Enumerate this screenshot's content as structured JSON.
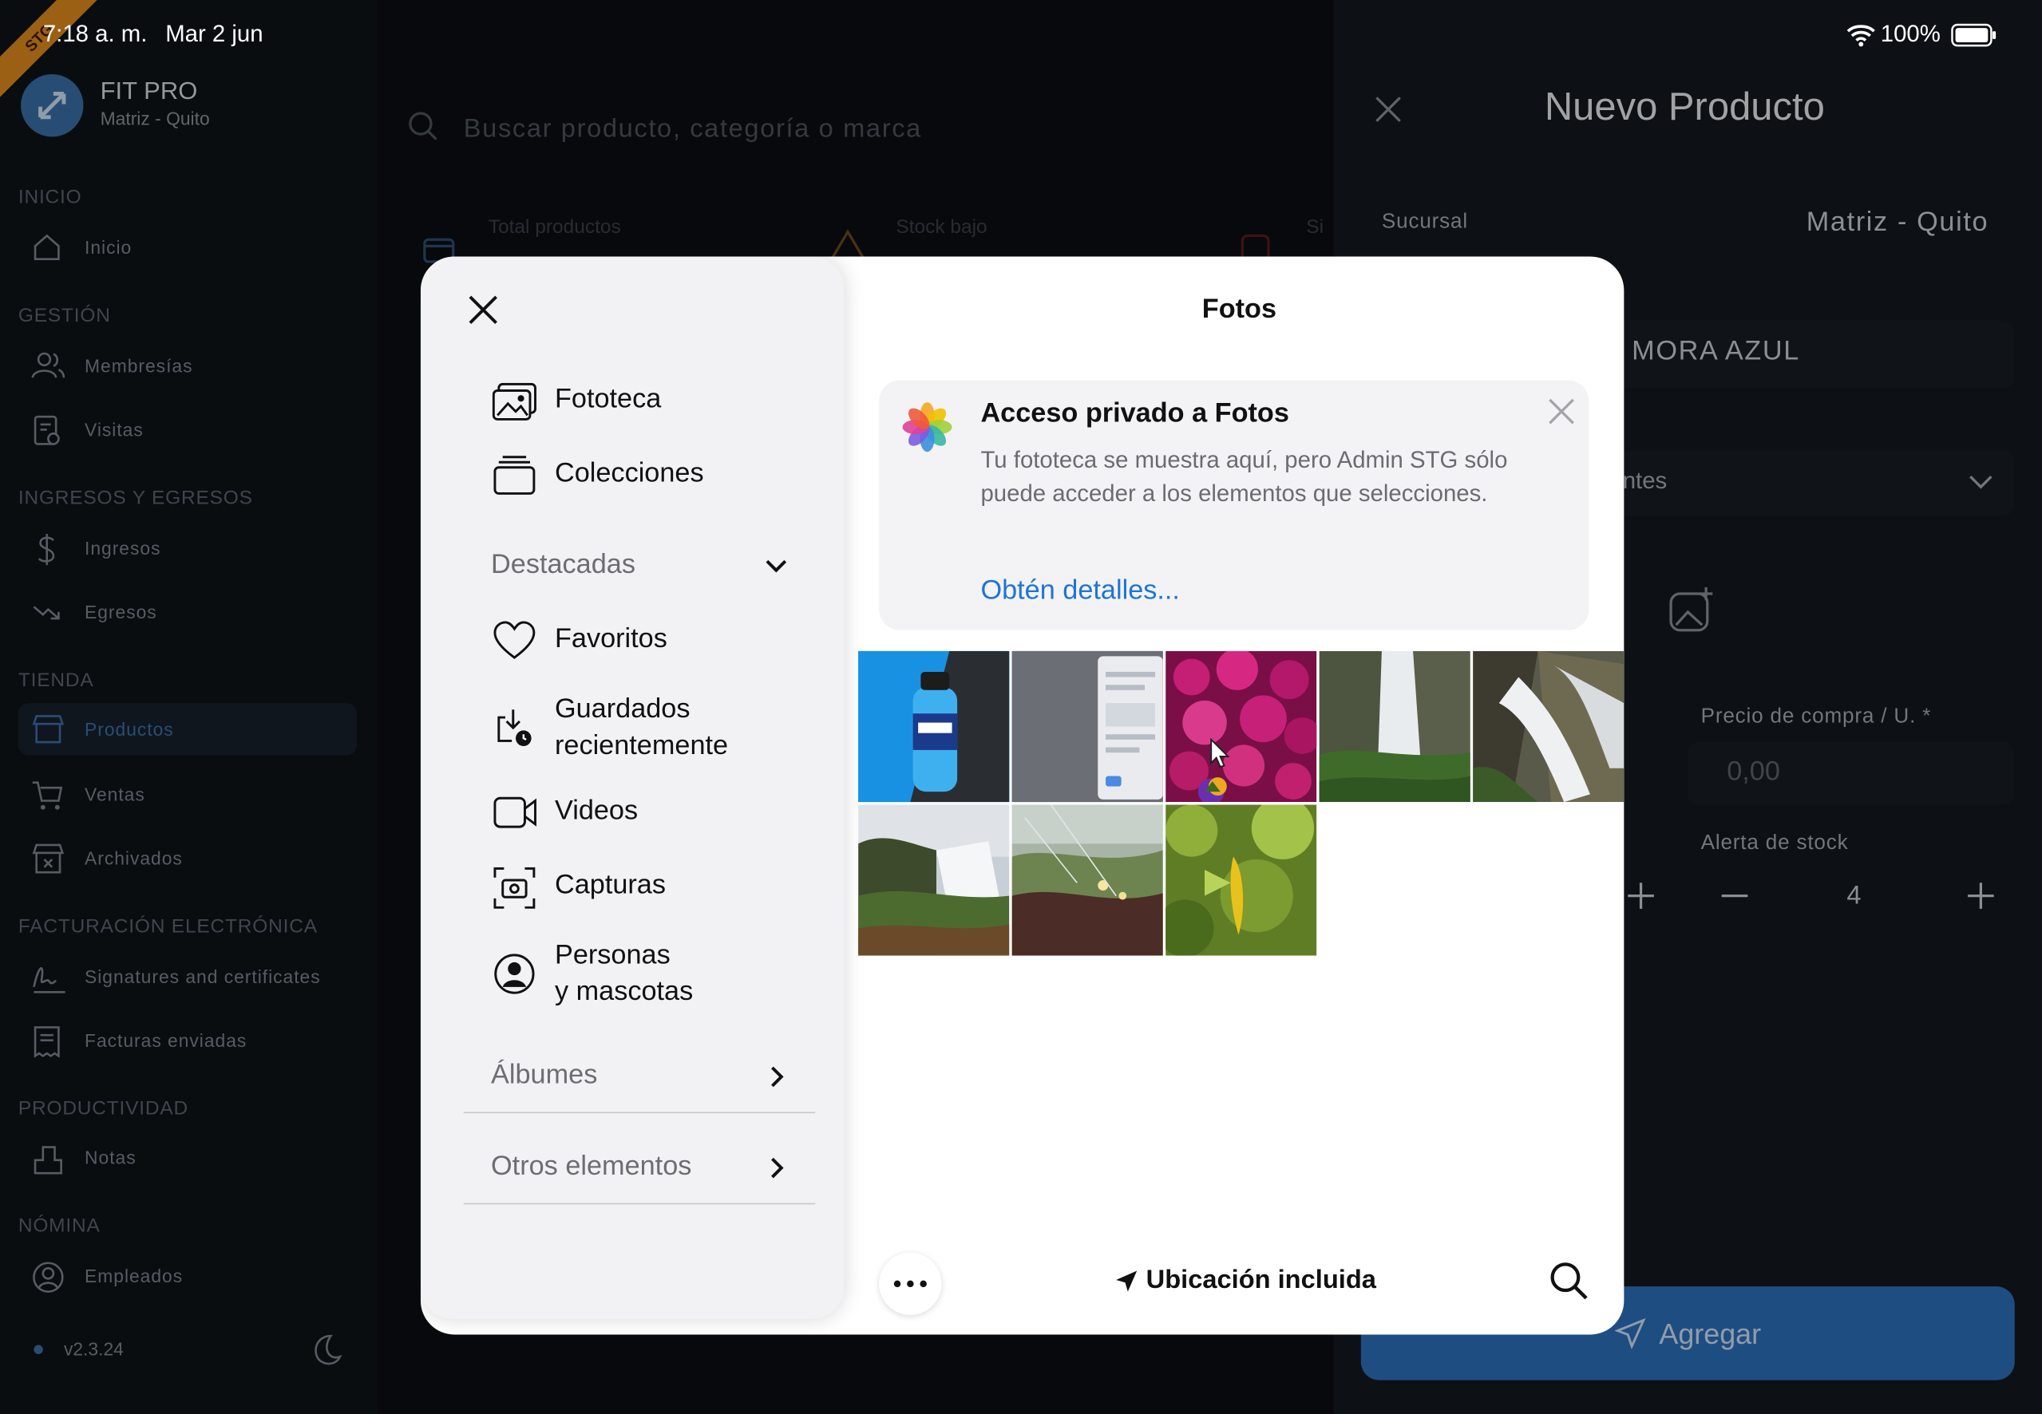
{
  "status_bar": {
    "time": "7:18 a. m.",
    "date": "Mar 2 jun",
    "battery": "100%",
    "ribbon": "STG"
  },
  "app": {
    "name": "FIT PRO",
    "branch": "Matriz - Quito"
  },
  "sidebar": {
    "sections": [
      {
        "title": "INICIO",
        "items": [
          {
            "label": "Inicio",
            "icon": "home-icon"
          }
        ]
      },
      {
        "title": "GESTIÓN",
        "items": [
          {
            "label": "Membresías",
            "icon": "users-icon"
          },
          {
            "label": "Visitas",
            "icon": "visits-icon"
          }
        ]
      },
      {
        "title": "INGRESOS Y EGRESOS",
        "items": [
          {
            "label": "Ingresos",
            "icon": "dollar-icon"
          },
          {
            "label": "Egresos",
            "icon": "trend-down-icon"
          }
        ]
      },
      {
        "title": "TIENDA",
        "items": [
          {
            "label": "Productos",
            "icon": "store-icon",
            "active": true
          },
          {
            "label": "Ventas",
            "icon": "cart-icon"
          },
          {
            "label": "Archivados",
            "icon": "archive-store-icon"
          }
        ]
      },
      {
        "title": "FACTURACIÓN ELECTRÓNICA",
        "items": [
          {
            "label": "Signatures and certificates",
            "icon": "signature-icon"
          },
          {
            "label": "Facturas enviadas",
            "icon": "receipt-icon"
          }
        ]
      },
      {
        "title": "PRODUCTIVIDAD",
        "items": [
          {
            "label": "Notas",
            "icon": "notes-icon"
          }
        ]
      },
      {
        "title": "NÓMINA",
        "items": [
          {
            "label": "Empleados",
            "icon": "employee-icon"
          }
        ]
      }
    ],
    "version": "v2.3.24"
  },
  "main": {
    "search_placeholder": "Buscar producto, categoría o marca",
    "stats": [
      {
        "label": "Total productos"
      },
      {
        "label": "Stock bajo"
      },
      {
        "label": "Si"
      }
    ]
  },
  "new_product_panel": {
    "title": "Nuevo Producto",
    "branch_label": "Sucursal",
    "branch_value": "Matriz - Quito",
    "name_value": "MORA AZUL",
    "category_partial": "ntes",
    "purchase_price_label": "Precio de compra / U. *",
    "purchase_price_placeholder": "0,00",
    "stock_alert_label": "Alerta de stock",
    "stock_alert_value": "4",
    "submit_label": "Agregar"
  },
  "photo_picker": {
    "title": "Fotos",
    "menu": [
      {
        "label": "Fototeca",
        "icon": "photo-library-icon"
      },
      {
        "label": "Colecciones",
        "icon": "collections-icon"
      }
    ],
    "featured_header": "Destacadas",
    "featured": [
      {
        "label": "Favoritos",
        "icon": "heart-icon"
      },
      {
        "label": "Guardados\nrecientemente",
        "icon": "recently-saved-icon"
      },
      {
        "label": "Videos",
        "icon": "video-icon"
      },
      {
        "label": "Capturas",
        "icon": "screenshot-icon"
      },
      {
        "label": "Personas\ny mascotas",
        "icon": "person-icon"
      }
    ],
    "albums_label": "Álbumes",
    "other_label": "Otros elementos",
    "notice": {
      "title": "Acceso privado a Fotos",
      "body": "Tu fototeca se muestra aquí, pero Admin STG sólo puede acceder a los elementos que selecciones.",
      "link": "Obtén detalles..."
    },
    "location_label": "Ubicación incluida",
    "photos": [
      {
        "subject": "blue-sports-drink-bottle"
      },
      {
        "subject": "app-screenshot"
      },
      {
        "subject": "pink-purple-flowers"
      },
      {
        "subject": "waterfall-cliff"
      },
      {
        "subject": "waterfall-rocks"
      },
      {
        "subject": "waterfall-coast"
      },
      {
        "subject": "coastal-grass"
      },
      {
        "subject": "yellow-flower-leaves"
      }
    ]
  }
}
